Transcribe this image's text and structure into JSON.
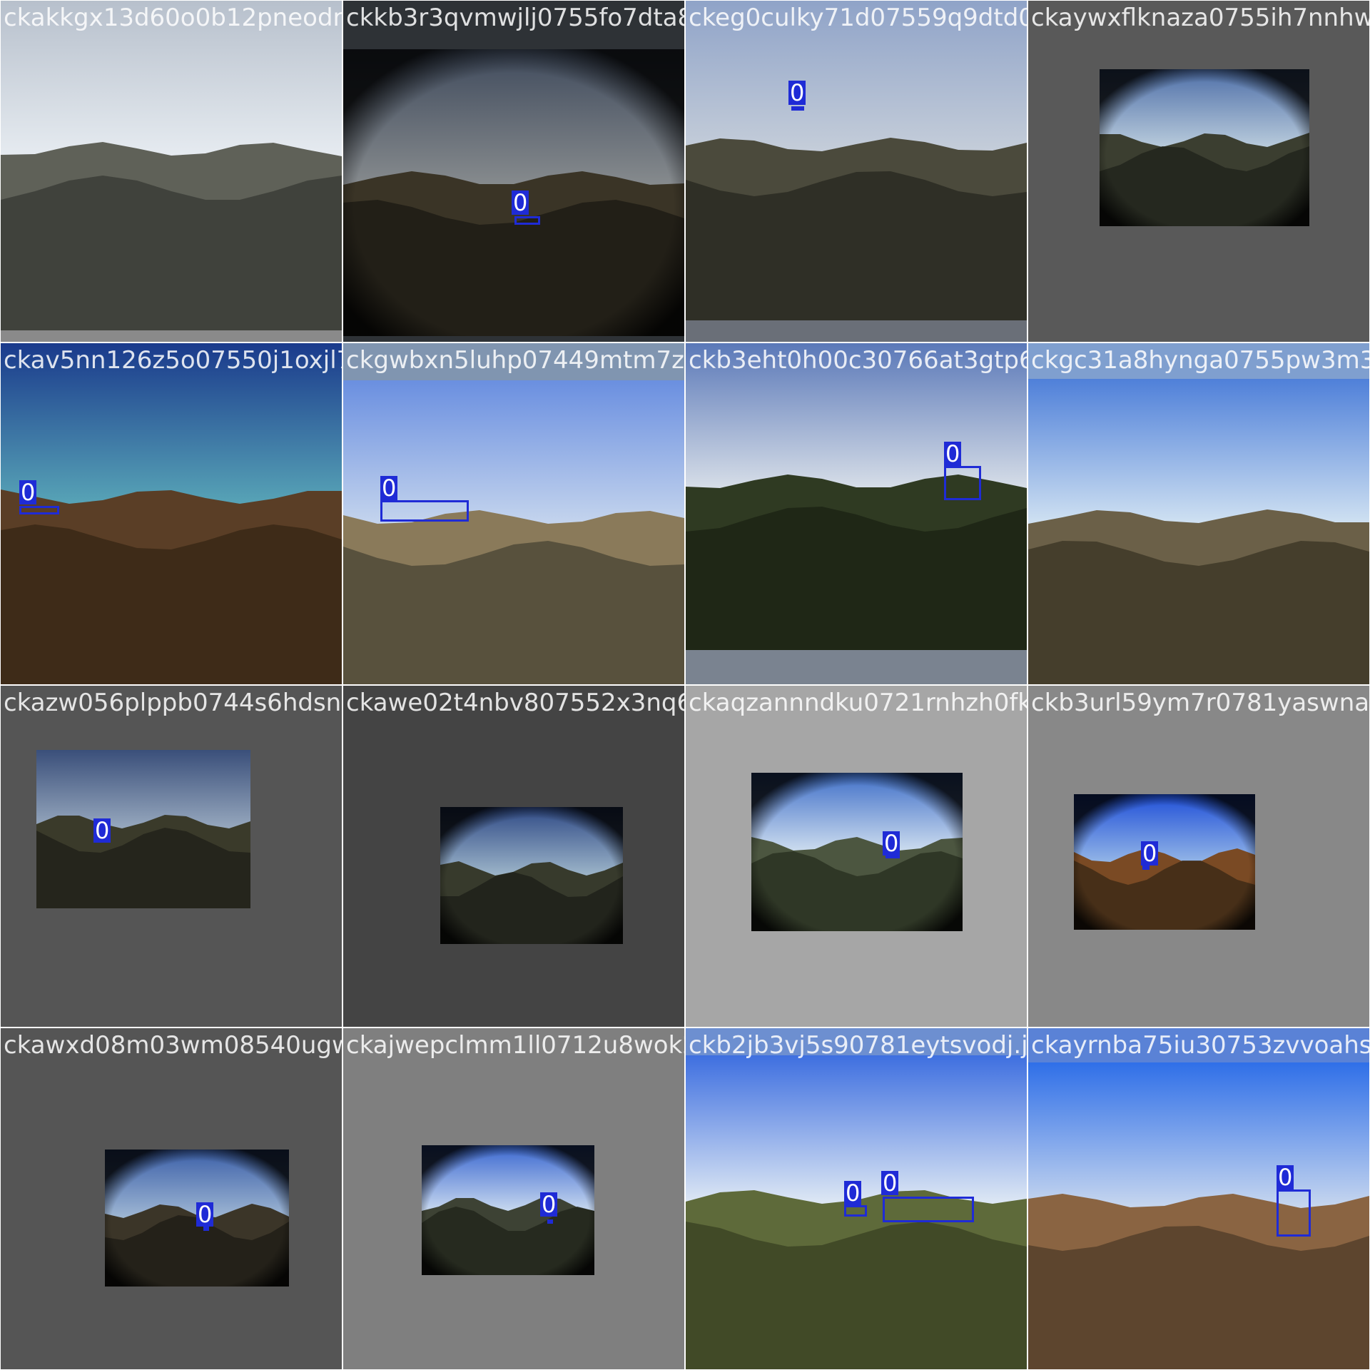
{
  "mosaic": {
    "tiles": [
      {
        "filename": "ckakkgx13d60o0b12pneodr8x.jpeg",
        "background": "#8a8a8a",
        "scene": {
          "sky_top": "#b7c0cc",
          "sky_bottom": "#e8edf2",
          "land": "#5f6158",
          "land_dark": "#3b3d37",
          "vignette": false
        },
        "detections": []
      },
      {
        "filename": "ckkb3r3qvmwjlj0755fo7dta8s.jpeg",
        "background": "#2e3236",
        "scene": {
          "sky_top": "#3f4a5c",
          "sky_bottom": "#8a8e90",
          "land": "#3a3426",
          "land_dark": "#1f1c15",
          "vignette": true
        },
        "detections": [
          {
            "class_label": "0"
          }
        ]
      },
      {
        "filename": "ckeg0culky71d07559q9dtd0r.jpeg",
        "background": "#6a6f78",
        "scene": {
          "sky_top": "#8fa3c8",
          "sky_bottom": "#c7cfda",
          "land": "#4b4a3c",
          "land_dark": "#2a2a22",
          "vignette": false
        },
        "detections": [
          {
            "class_label": "0"
          }
        ]
      },
      {
        "filename": "ckaywxflknaza0755ih7nnhwg.jpeg",
        "background": "#595959",
        "scene": {
          "sky_top": "#4e6fa8",
          "sky_bottom": "#c2d3e0",
          "land": "#3b3e30",
          "land_dark": "#22241c",
          "vignette": true
        },
        "detections": []
      },
      {
        "filename": "ckav5nn126z5o07550j1oxjl7.jpeg",
        "background": "#18315a",
        "scene": {
          "sky_top": "#1a3a8c",
          "sky_bottom": "#5aa8b8",
          "land": "#5a3e26",
          "land_dark": "#3a2816",
          "vignette": false
        },
        "detections": [
          {
            "class_label": "0"
          }
        ]
      },
      {
        "filename": "ckgwbxn5luhp07449mtm7z5kb.jpeg",
        "background": "#8095b0",
        "scene": {
          "sky_top": "#6a8fe0",
          "sky_bottom": "#c9d8ee",
          "land": "#8a7a5a",
          "land_dark": "#4f4a38",
          "vignette": false
        },
        "detections": [
          {
            "class_label": "0"
          }
        ]
      },
      {
        "filename": "ckb3eht0h00c30766at3gtp6i.jpeg",
        "background": "#7a8390",
        "scene": {
          "sky_top": "#5a78b8",
          "sky_bottom": "#dde3ea",
          "land": "#2f3a22",
          "land_dark": "#1c2414",
          "vignette": false
        },
        "detections": [
          {
            "class_label": "0"
          }
        ]
      },
      {
        "filename": "ckgc31a8hynga0755pw3m3k.jpeg",
        "background": "#7f9fcf",
        "scene": {
          "sky_top": "#4f80d9",
          "sky_bottom": "#d6e6f3",
          "land": "#6b6048",
          "land_dark": "#3e3828",
          "vignette": false
        },
        "detections": []
      },
      {
        "filename": "ckazw056plppb0744s6hdsnoh.jpeg",
        "background": "#555555",
        "scene": {
          "sky_top": "#3a4f7a",
          "sky_bottom": "#9fb0c4",
          "land": "#3a3a2a",
          "land_dark": "#22221a",
          "vignette": false
        },
        "detections": [
          {
            "class_label": "0"
          }
        ]
      },
      {
        "filename": "ckawe02t4nbv807552x3nq677.jpeg",
        "background": "#444444",
        "scene": {
          "sky_top": "#2f4a86",
          "sky_bottom": "#a8c0d0",
          "land": "#373a2c",
          "land_dark": "#1f211a",
          "vignette": true
        },
        "detections": []
      },
      {
        "filename": "ckaqzannndku0721rnhzh0fkb.jpeg",
        "background": "#a6a6a6",
        "scene": {
          "sky_top": "#3f6fc8",
          "sky_bottom": "#d9e6f2",
          "land": "#4c5640",
          "land_dark": "#2a3122",
          "vignette": true
        },
        "detections": [
          {
            "class_label": "0"
          }
        ]
      },
      {
        "filename": "ckb3url59ym7r0781yaswna5.jpeg",
        "background": "#888888",
        "scene": {
          "sky_top": "#1f4fd8",
          "sky_bottom": "#9fc0e8",
          "land": "#7a4a24",
          "land_dark": "#3e2a16",
          "vignette": true
        },
        "detections": [
          {
            "class_label": "0"
          }
        ]
      },
      {
        "filename": "ckawxd08m03wm08540ugwjdk.jpeg",
        "background": "#555555",
        "scene": {
          "sky_top": "#3b5fa8",
          "sky_bottom": "#a9c0d8",
          "land": "#3b3528",
          "land_dark": "#211d16",
          "vignette": true
        },
        "detections": [
          {
            "class_label": "0"
          }
        ]
      },
      {
        "filename": "ckajwepclmm1ll0712u8wok2r.jpeg",
        "background": "#7f7f7f",
        "scene": {
          "sky_top": "#3a67d0",
          "sky_bottom": "#d6e4f2",
          "land": "#3d4234",
          "land_dark": "#22261c",
          "vignette": true
        },
        "detections": [
          {
            "class_label": "0"
          }
        ]
      },
      {
        "filename": "ckb2jb3vj5s90781eytsvodj.jpeg",
        "background": "#6d8fd0",
        "scene": {
          "sky_top": "#3e6fe0",
          "sky_bottom": "#e6eef5",
          "land": "#5e6a3a",
          "land_dark": "#3c4424",
          "vignette": false
        },
        "detections": [
          {
            "class_label": "0"
          },
          {
            "class_label": "0"
          }
        ]
      },
      {
        "filename": "ckayrnba75iu30753zvvoahsp.jpeg",
        "background": "#5a82d6",
        "scene": {
          "sky_top": "#2f6fe8",
          "sky_bottom": "#cfdcef",
          "land": "#8a6442",
          "land_dark": "#55402a",
          "vignette": false
        },
        "detections": [
          {
            "class_label": "0"
          }
        ]
      }
    ]
  },
  "colors": {
    "detection_box": "#1f2bd6",
    "filename_text": "#ffffff"
  }
}
